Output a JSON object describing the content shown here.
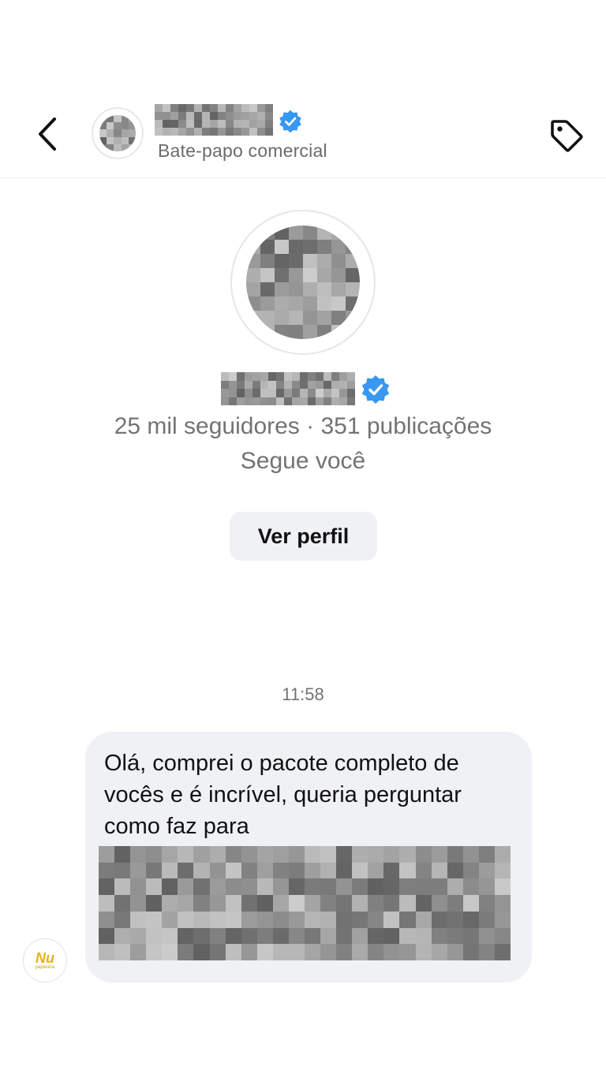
{
  "header": {
    "back_icon": "chevron-left-icon",
    "subtitle": "Bate-papo comercial",
    "tag_icon": "tag-icon",
    "verified_icon": "verified-badge-icon"
  },
  "profile": {
    "stats": "25 mil seguidores · 351 publicações",
    "follow_status": "Segue você",
    "view_profile_label": "Ver perfil"
  },
  "chat": {
    "timestamp": "11:58",
    "sender_logo_text": "Nu",
    "sender_logo_subtext": "papelaria",
    "message_text": "Olá, comprei o pacote completo de vocês e é incrível, queria perguntar como faz para"
  },
  "colors": {
    "accent_verified": "#3897f0",
    "bubble_bg": "#eff1f4",
    "secondary_text": "#737373",
    "logo_yellow": "#e3b316"
  }
}
